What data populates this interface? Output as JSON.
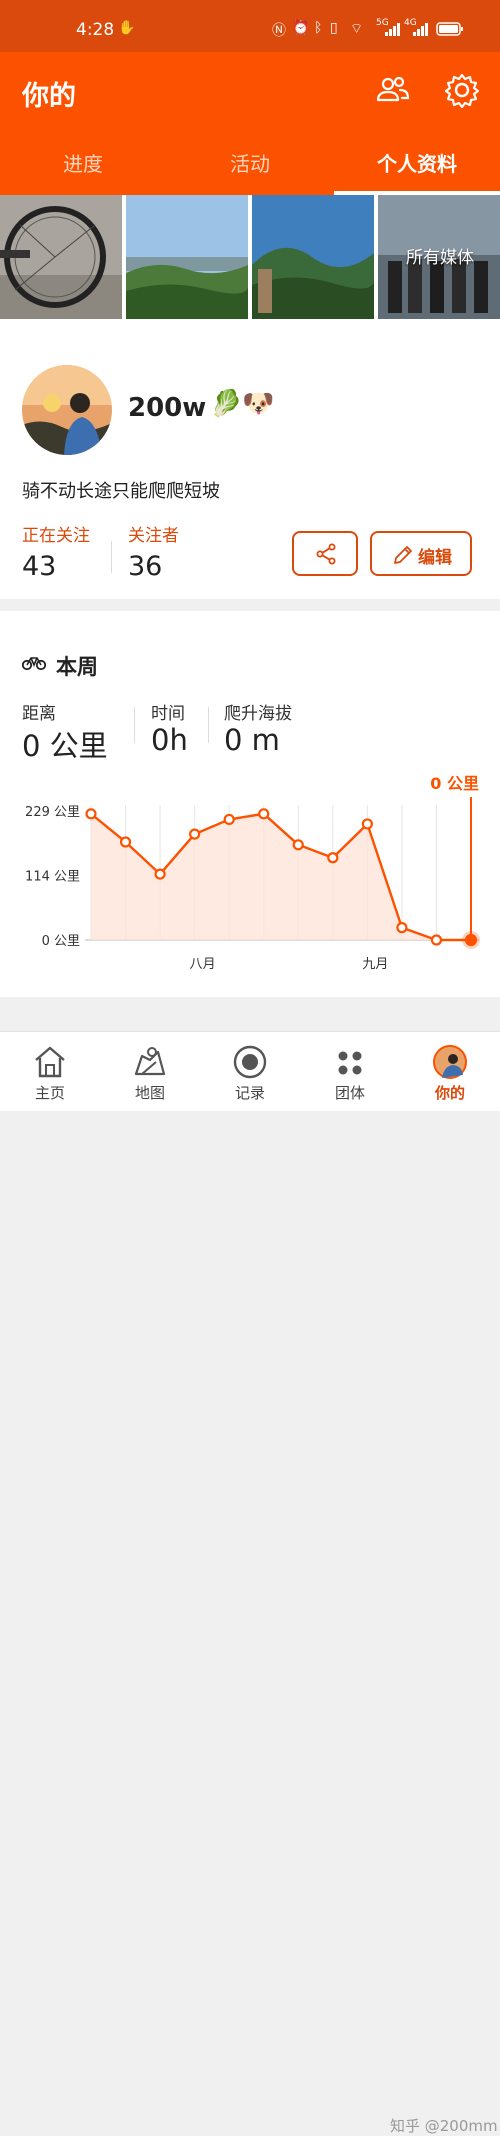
{
  "status_bar": {
    "time": "4:28",
    "sig1": "5G",
    "sig2": "4G"
  },
  "header": {
    "title": "你的"
  },
  "tabs": [
    {
      "label": "进度"
    },
    {
      "label": "活动"
    },
    {
      "label": "个人资料"
    }
  ],
  "media": {
    "all_media_label": "所有媒体"
  },
  "profile": {
    "name": "200w",
    "emojis": [
      "🥬",
      "🐶"
    ],
    "bio": "骑不动长途只能爬爬短坡",
    "following_label": "正在关注",
    "following_count": "43",
    "followers_label": "关注者",
    "followers_count": "36",
    "edit_label": "编辑"
  },
  "week": {
    "title": "本周",
    "stats": [
      {
        "label": "距离",
        "value": "0 公里"
      },
      {
        "label": "时间",
        "value": "0h"
      },
      {
        "label": "爬升海拔",
        "value": "0 m"
      }
    ]
  },
  "chart_data": {
    "type": "line",
    "current_label": "0 公里",
    "y_ticks": [
      "229 公里",
      "114 公里",
      "0 公里"
    ],
    "ylim": [
      0,
      229
    ],
    "x_labels": [
      {
        "label": "八月",
        "index": 3
      },
      {
        "label": "九月",
        "index": 8
      }
    ],
    "values": [
      224,
      174,
      117,
      188,
      214,
      224,
      169,
      146,
      206,
      22,
      0,
      0
    ],
    "accent": "#fc5200"
  },
  "bottom_nav": [
    {
      "label": "主页",
      "icon": "home-icon"
    },
    {
      "label": "地图",
      "icon": "map-icon"
    },
    {
      "label": "记录",
      "icon": "record-icon"
    },
    {
      "label": "团体",
      "icon": "groups-icon"
    },
    {
      "label": "你的",
      "icon": "avatar-icon"
    }
  ],
  "watermark": "知乎 @200mm"
}
